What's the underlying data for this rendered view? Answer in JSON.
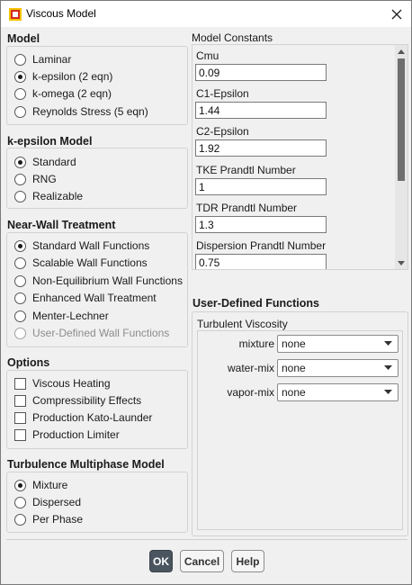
{
  "window": {
    "title": "Viscous Model",
    "close_icon": "close-icon"
  },
  "model": {
    "title": "Model",
    "options": [
      {
        "label": "Laminar",
        "selected": false
      },
      {
        "label": "k-epsilon (2 eqn)",
        "selected": true
      },
      {
        "label": "k-omega (2 eqn)",
        "selected": false
      },
      {
        "label": "Reynolds Stress (5 eqn)",
        "selected": false
      }
    ]
  },
  "k_epsilon_model": {
    "title": "k-epsilon Model",
    "options": [
      {
        "label": "Standard",
        "selected": true
      },
      {
        "label": "RNG",
        "selected": false
      },
      {
        "label": "Realizable",
        "selected": false
      }
    ]
  },
  "near_wall": {
    "title": "Near-Wall Treatment",
    "options": [
      {
        "label": "Standard Wall Functions",
        "selected": true,
        "enabled": true
      },
      {
        "label": "Scalable Wall Functions",
        "selected": false,
        "enabled": true
      },
      {
        "label": "Non-Equilibrium Wall Functions",
        "selected": false,
        "enabled": true
      },
      {
        "label": "Enhanced Wall Treatment",
        "selected": false,
        "enabled": true
      },
      {
        "label": "Menter-Lechner",
        "selected": false,
        "enabled": true
      },
      {
        "label": "User-Defined Wall Functions",
        "selected": false,
        "enabled": false
      }
    ]
  },
  "options": {
    "title": "Options",
    "items": [
      {
        "label": "Viscous Heating",
        "checked": false
      },
      {
        "label": "Compressibility Effects",
        "checked": false
      },
      {
        "label": "Production Kato-Launder",
        "checked": false
      },
      {
        "label": "Production Limiter",
        "checked": false
      }
    ]
  },
  "multiphase": {
    "title": "Turbulence Multiphase Model",
    "options": [
      {
        "label": "Mixture",
        "selected": true
      },
      {
        "label": "Dispersed",
        "selected": false
      },
      {
        "label": "Per Phase",
        "selected": false
      }
    ]
  },
  "model_constants": {
    "title": "Model Constants",
    "items": [
      {
        "label": "Cmu",
        "value": "0.09"
      },
      {
        "label": "C1-Epsilon",
        "value": "1.44"
      },
      {
        "label": "C2-Epsilon",
        "value": "1.92"
      },
      {
        "label": "TKE Prandtl Number",
        "value": "1"
      },
      {
        "label": "TDR Prandtl Number",
        "value": "1.3"
      },
      {
        "label": "Dispersion Prandtl Number",
        "value": "0.75"
      }
    ]
  },
  "udf": {
    "title": "User-Defined Functions",
    "subtitle": "Turbulent Viscosity",
    "rows": [
      {
        "label": "mixture",
        "value": "none"
      },
      {
        "label": "water-mix",
        "value": "none"
      },
      {
        "label": "vapor-mix",
        "value": "none"
      }
    ]
  },
  "buttons": {
    "ok": "OK",
    "cancel": "Cancel",
    "help": "Help"
  }
}
